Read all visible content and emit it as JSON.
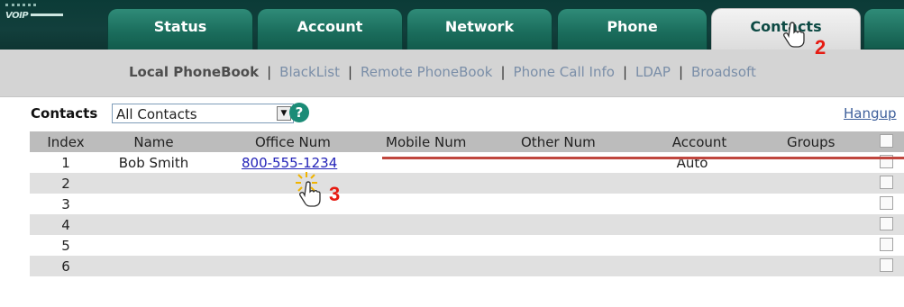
{
  "app": {
    "logo_text": "VOIP"
  },
  "tabs": [
    {
      "label": "Status"
    },
    {
      "label": "Account"
    },
    {
      "label": "Network"
    },
    {
      "label": "Phone"
    },
    {
      "label": "Contacts"
    }
  ],
  "subnav": {
    "items": [
      {
        "label": "Local PhoneBook"
      },
      {
        "label": "BlackList"
      },
      {
        "label": "Remote PhoneBook"
      },
      {
        "label": "Phone Call Info"
      },
      {
        "label": "LDAP"
      },
      {
        "label": "Broadsoft"
      }
    ],
    "separator": "|"
  },
  "filter": {
    "label": "Contacts",
    "selected": "All Contacts",
    "help": "?"
  },
  "hangup": "Hangup",
  "table": {
    "columns": [
      "Index",
      "Name",
      "Office Num",
      "Mobile Num",
      "Other Num",
      "Account",
      "Groups"
    ],
    "rows": [
      {
        "index": "1",
        "name": "Bob Smith",
        "office": "800-555-1234",
        "mobile": "",
        "other": "",
        "account": "Auto",
        "groups": ""
      },
      {
        "index": "2",
        "name": "",
        "office": "",
        "mobile": "",
        "other": "",
        "account": "",
        "groups": ""
      },
      {
        "index": "3",
        "name": "",
        "office": "",
        "mobile": "",
        "other": "",
        "account": "",
        "groups": ""
      },
      {
        "index": "4",
        "name": "",
        "office": "",
        "mobile": "",
        "other": "",
        "account": "",
        "groups": ""
      },
      {
        "index": "5",
        "name": "",
        "office": "",
        "mobile": "",
        "other": "",
        "account": "",
        "groups": ""
      },
      {
        "index": "6",
        "name": "",
        "office": "",
        "mobile": "",
        "other": "",
        "account": "",
        "groups": ""
      }
    ]
  },
  "annotations": {
    "step2": "2",
    "step3": "3"
  },
  "colors": {
    "tab_bg": "#1b6e5d",
    "topbar_bg": "#123f3c",
    "active_tab_bg": "#e6e6e6",
    "subnav_bg": "#d4d4d4",
    "link": "#2323b8",
    "annotation_red": "#e61b12"
  }
}
